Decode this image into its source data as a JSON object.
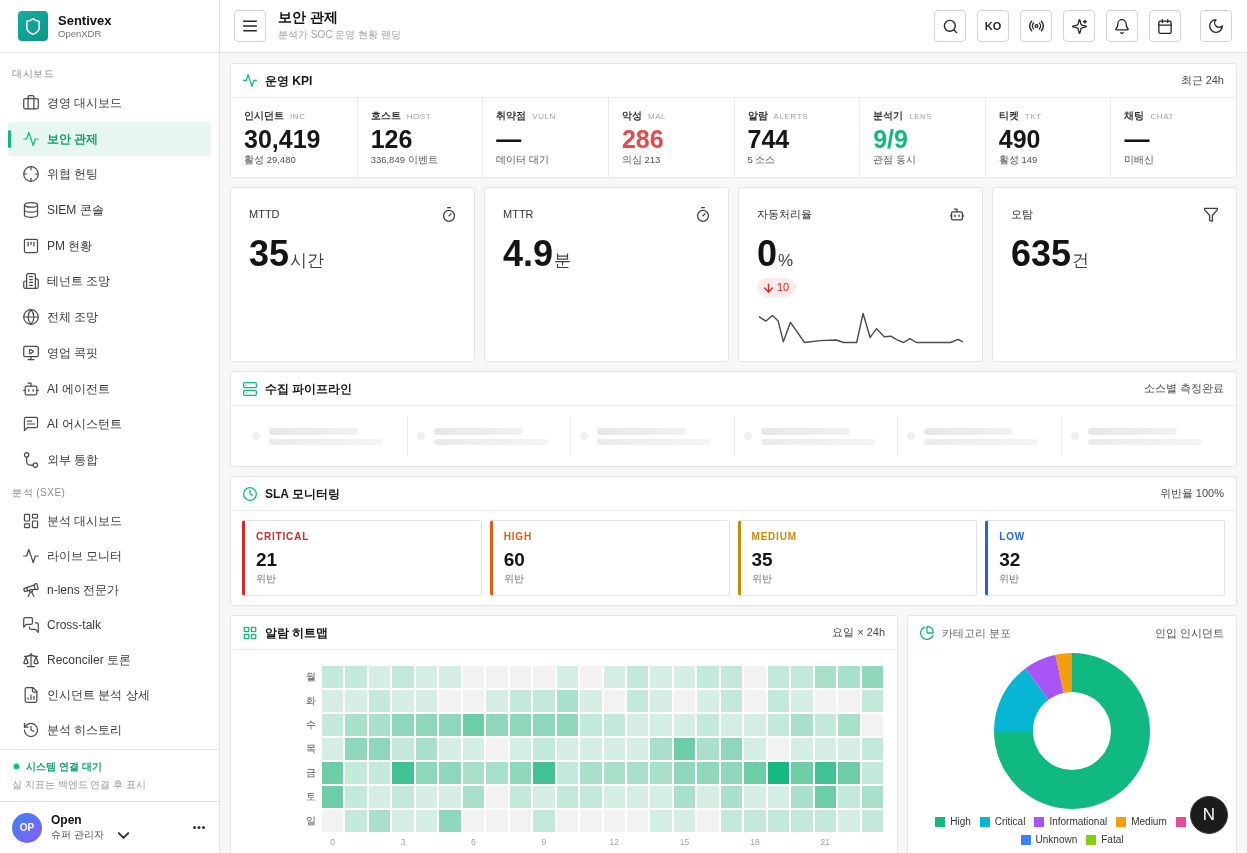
{
  "sidebar": {
    "brand": {
      "name": "Sentivex",
      "tagline": "OpenXDR"
    },
    "sections": [
      {
        "label": "대시보드",
        "items": [
          {
            "label": "경영 대시보드",
            "selected": false
          },
          {
            "label": "보안 관제",
            "selected": true
          },
          {
            "label": "위협 헌팅",
            "selected": false
          },
          {
            "label": "SIEM 콘솔",
            "selected": false
          },
          {
            "label": "PM 현황",
            "selected": false
          },
          {
            "label": "테넌트 조망",
            "selected": false
          },
          {
            "label": "전체 조망",
            "selected": false
          },
          {
            "label": "영업 콕핏",
            "selected": false
          },
          {
            "label": "AI 에이전트",
            "selected": false
          },
          {
            "label": "AI 어시스턴트",
            "selected": false
          },
          {
            "label": "외부 통합",
            "selected": false
          }
        ]
      },
      {
        "label": "분석 (SXE)",
        "items": [
          {
            "label": "분석 대시보드",
            "selected": false
          },
          {
            "label": "라이브 모니터",
            "selected": false
          },
          {
            "label": "n-lens 전문가",
            "selected": false
          },
          {
            "label": "Cross-talk",
            "selected": false
          },
          {
            "label": "Reconciler 토론",
            "selected": false
          },
          {
            "label": "인시던트 분석 상세",
            "selected": false
          },
          {
            "label": "분석 히스토리",
            "selected": false
          }
        ]
      }
    ],
    "status": {
      "label": "시스템 연결 대기",
      "note": "실 지표는 백엔드 연결 후 표시"
    },
    "user": {
      "initials": "OP",
      "name": "Open",
      "role": "슈퍼 관리자"
    }
  },
  "header": {
    "title": "보안 관제",
    "subtitle": "분석가 SOC 운영 현황 랜딩",
    "language": "KO"
  },
  "kpi": {
    "title": "운영 KPI",
    "note": "최근 24h",
    "items": [
      {
        "label": "인시던트",
        "code": "INC",
        "value": "30,419",
        "sub": "활성 29,480",
        "color": "#171717"
      },
      {
        "label": "호스트",
        "code": "HOST",
        "value": "126",
        "sub": "336,849 이벤트",
        "color": "#171717"
      },
      {
        "label": "취약점",
        "code": "VULN",
        "value": "—",
        "sub": "데이터 대기",
        "color": "#171717"
      },
      {
        "label": "악성",
        "code": "MAL",
        "value": "286",
        "sub": "의심 213",
        "color": "#e5484d"
      },
      {
        "label": "알람",
        "code": "ALERTS",
        "value": "744",
        "sub": "5 소스",
        "color": "#171717"
      },
      {
        "label": "분석기",
        "code": "LENS",
        "value": "9/9",
        "sub": "관점 동시",
        "color": "#10b981"
      },
      {
        "label": "티켓",
        "code": "TKT",
        "value": "490",
        "sub": "활성 149",
        "color": "#171717"
      },
      {
        "label": "채팅",
        "code": "CHAT",
        "value": "—",
        "sub": "미배신",
        "color": "#171717"
      }
    ]
  },
  "metrics": [
    {
      "label": "MTTD",
      "value": "35",
      "unit": "시간"
    },
    {
      "label": "MTTR",
      "value": "4.9",
      "unit": "분"
    },
    {
      "label": "자동처리율",
      "value": "0",
      "unit": "%",
      "trend": {
        "value": "10",
        "negative": true
      },
      "sparkline": true
    },
    {
      "label": "오탐",
      "value": "635",
      "unit": "건"
    }
  ],
  "pipeline": {
    "title": "수집 파이프라인",
    "note": "소스별 측정완료",
    "loading": true
  },
  "sla": {
    "title": "SLA 모니터링",
    "note": "위반율 100%",
    "items": [
      {
        "label": "CRITICAL",
        "value": "21",
        "note": "위반",
        "color": "#dc2626"
      },
      {
        "label": "HIGH",
        "value": "60",
        "note": "위반",
        "color": "#ea580c"
      },
      {
        "label": "MEDIUM",
        "value": "35",
        "note": "위반",
        "color": "#ca8a04"
      },
      {
        "label": "LOW",
        "value": "32",
        "note": "위반",
        "color": "#2563eb"
      }
    ]
  },
  "heatmap": {
    "title": "알람 히트맵",
    "note": "요일 × 24h",
    "days": [
      "월",
      "화",
      "수",
      "목",
      "금",
      "토",
      "일"
    ],
    "hour_ticks": [
      "0",
      "3",
      "6",
      "9",
      "12",
      "15",
      "18",
      "21"
    ]
  },
  "category_chart": {
    "title": "카테고리 분포",
    "note": "인입 인시던트",
    "chart_data": {
      "type": "donut",
      "categories": [
        "High",
        "Critical",
        "Informational",
        "Medium"
      ],
      "values": [
        75,
        14.8,
        6.8,
        3.4
      ]
    },
    "legend": [
      {
        "color": "#10b981"
      },
      {
        "color": "#06b6d4"
      },
      {
        "color": "#a855f7"
      },
      {
        "color": "#f59e0b"
      },
      {
        "color": "#ec4899"
      },
      {
        "label": "Unknown",
        "color": "#3b82f6"
      },
      {
        "label": "Fatal",
        "color": "#84cc16"
      }
    ]
  },
  "dev_badge": {
    "label": "N"
  }
}
